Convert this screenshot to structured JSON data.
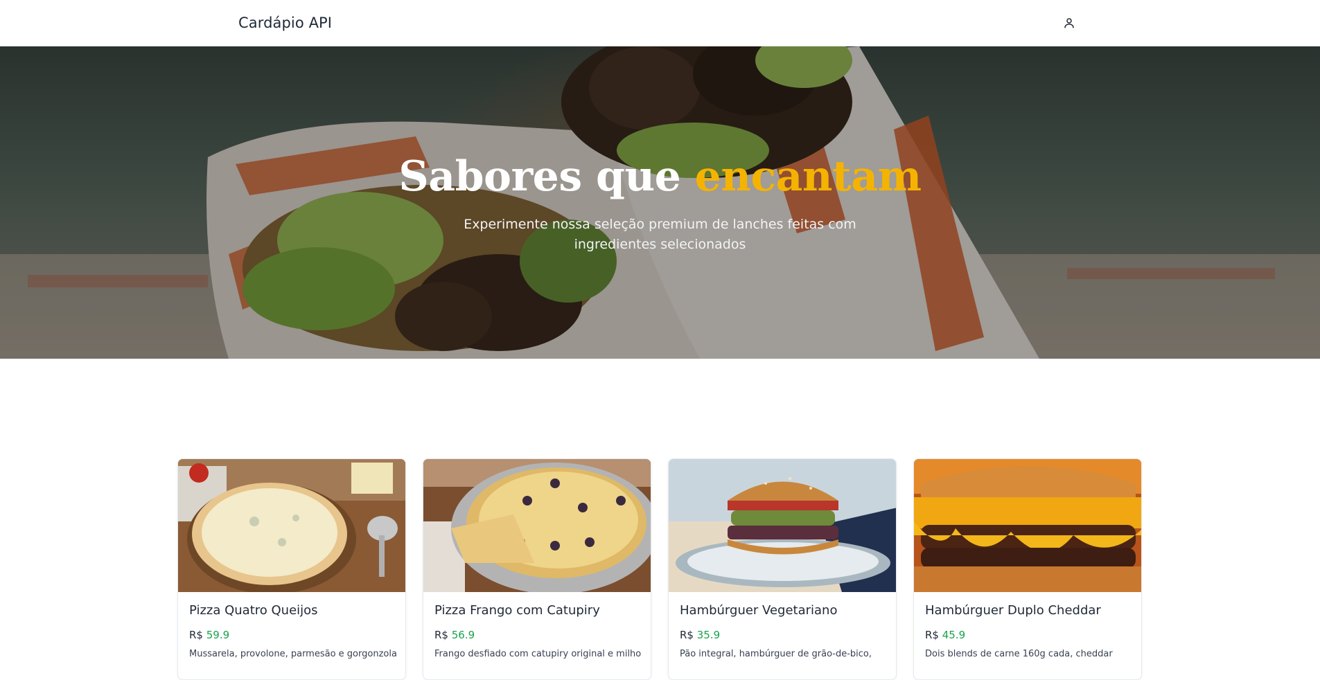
{
  "header": {
    "brand": "Cardápio API",
    "user_icon": "user-icon"
  },
  "hero": {
    "title_main": "Sabores que",
    "title_accent": "encantam",
    "subtitle": "Experimente nossa seleção premium de lanches feitas com ingredientes selecionados",
    "accent_color": "#f5b301"
  },
  "products": [
    {
      "name": "Pizza Quatro Queijos",
      "currency": "R$",
      "price": "59.9",
      "description": "Mussarela, provolone, parmesão e gorgonzola"
    },
    {
      "name": "Pizza Frango com Catupiry",
      "currency": "R$",
      "price": "56.9",
      "description": "Frango desfiado com catupiry original e milho"
    },
    {
      "name": "Hambúrguer Vegetariano",
      "currency": "R$",
      "price": "35.9",
      "description": "Pão integral, hambúrguer de grão-de-bico,"
    },
    {
      "name": "Hambúrguer Duplo Cheddar",
      "currency": "R$",
      "price": "45.9",
      "description": "Dois blends de carne 160g cada, cheddar"
    }
  ],
  "colors": {
    "price_green": "#16a34a",
    "text_dark": "#1f2937"
  }
}
